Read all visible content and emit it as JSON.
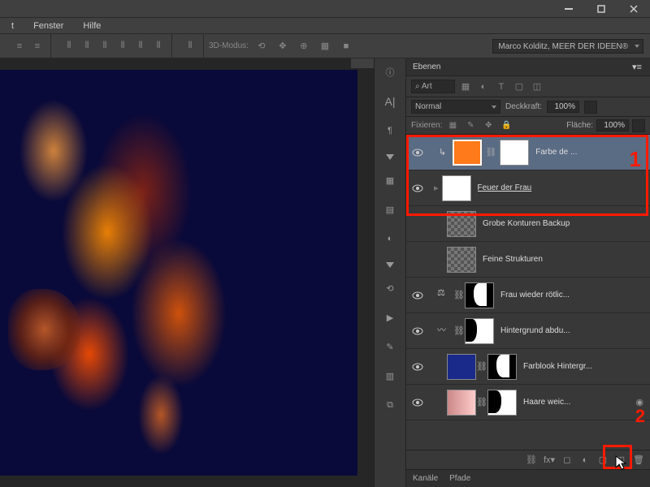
{
  "menu": {
    "window": "Fenster",
    "help": "Hilfe",
    "cut_t": "t"
  },
  "optbar": {
    "mode3d": "3D-Modus:",
    "user_drop": "Marco Kolditz, MEER DER IDEEN®"
  },
  "panel": {
    "title": "Ebenen",
    "search_prefix": "⌕ Art",
    "blend": "Normal",
    "opacity_label": "Deckkraft:",
    "opacity_val": "100%",
    "lock_label": "Fixieren:",
    "fill_label": "Fläche:",
    "fill_val": "100%"
  },
  "layers": [
    {
      "name": "Farbe de  ...",
      "selected": true,
      "clip": true
    },
    {
      "name": "Feuer der Frau",
      "under": true
    },
    {
      "name": "Grobe Konturen Backup"
    },
    {
      "name": "Feine Strukturen"
    },
    {
      "name": "Frau wieder rötlic..."
    },
    {
      "name": "Hintergrund abdu..."
    },
    {
      "name": "Farblook Hintergr..."
    },
    {
      "name": "Haare weic..."
    }
  ],
  "annot": {
    "n1": "1",
    "n2": "2"
  },
  "tabs": {
    "channels": "Kanäle",
    "paths": "Pfade"
  }
}
